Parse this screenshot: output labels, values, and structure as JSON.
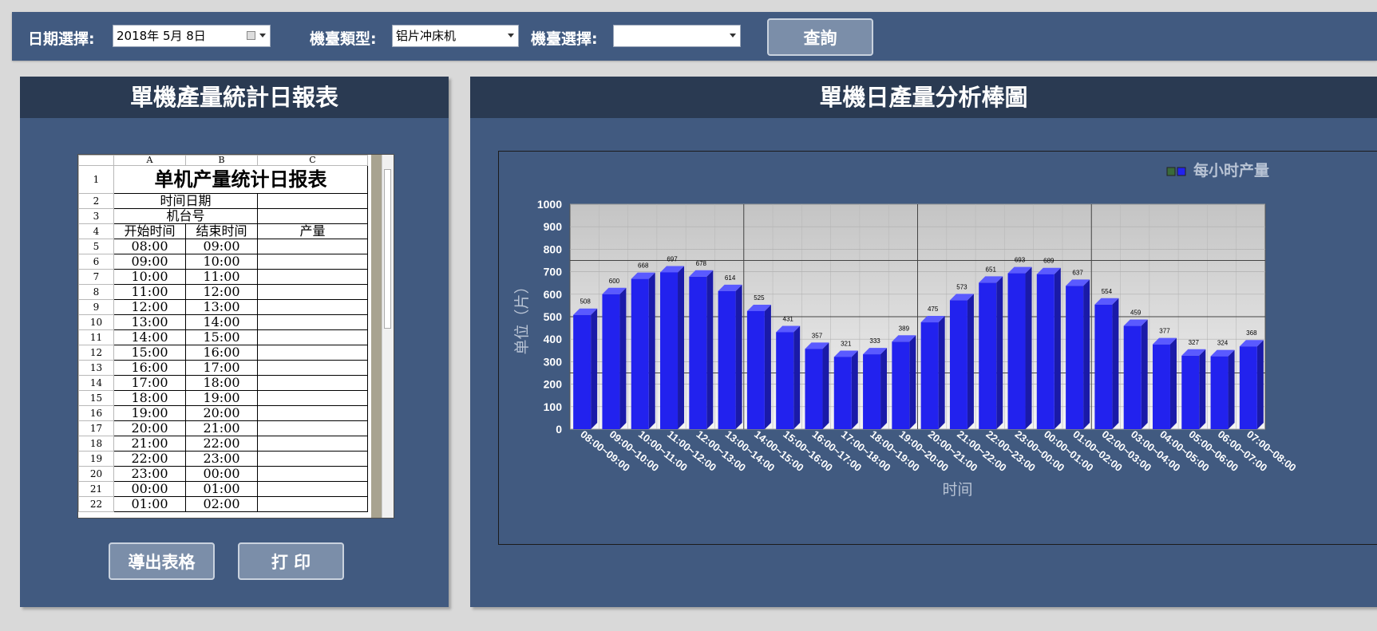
{
  "toolbar": {
    "date_label": "日期選擇:",
    "date_value": "2018年  5月  8日",
    "type_label": "機臺類型:",
    "type_value": "铝片冲床机",
    "machine_label": "機臺選擇:",
    "machine_value": "",
    "query_button": "查詢"
  },
  "left_panel": {
    "title": "單機產量統計日報表",
    "export_button": "導出表格",
    "print_button": "打 印"
  },
  "sheet": {
    "col_headers": [
      "A",
      "B",
      "C"
    ],
    "title": "单机产量统计日报表",
    "date_row_label": "时间日期",
    "machine_row_label": "机台号",
    "header_start": "开始时间",
    "header_end": "结束时间",
    "header_output": "产量",
    "rows": [
      {
        "n": "5",
        "start": "08:00",
        "end": "09:00"
      },
      {
        "n": "6",
        "start": "09:00",
        "end": "10:00"
      },
      {
        "n": "7",
        "start": "10:00",
        "end": "11:00"
      },
      {
        "n": "8",
        "start": "11:00",
        "end": "12:00"
      },
      {
        "n": "9",
        "start": "12:00",
        "end": "13:00"
      },
      {
        "n": "10",
        "start": "13:00",
        "end": "14:00"
      },
      {
        "n": "11",
        "start": "14:00",
        "end": "15:00"
      },
      {
        "n": "12",
        "start": "15:00",
        "end": "16:00"
      },
      {
        "n": "13",
        "start": "16:00",
        "end": "17:00"
      },
      {
        "n": "14",
        "start": "17:00",
        "end": "18:00"
      },
      {
        "n": "15",
        "start": "18:00",
        "end": "19:00"
      },
      {
        "n": "16",
        "start": "19:00",
        "end": "20:00"
      },
      {
        "n": "17",
        "start": "20:00",
        "end": "21:00"
      },
      {
        "n": "18",
        "start": "21:00",
        "end": "22:00"
      },
      {
        "n": "19",
        "start": "22:00",
        "end": "23:00"
      },
      {
        "n": "20",
        "start": "23:00",
        "end": "00:00"
      },
      {
        "n": "21",
        "start": "00:00",
        "end": "01:00"
      },
      {
        "n": "22",
        "start": "01:00",
        "end": "02:00"
      }
    ]
  },
  "right_panel": {
    "title": "單機日產量分析棒圖"
  },
  "chart_data": {
    "type": "bar",
    "legend": "每小时产量",
    "legend_position": "top-right",
    "ylabel": "单位（片）",
    "xlabel": "时间",
    "ylim": [
      0,
      1000
    ],
    "yticks": [
      0,
      100,
      200,
      300,
      400,
      500,
      600,
      700,
      800,
      900,
      1000
    ],
    "categories": [
      "08:00~09:00",
      "09:00~10:00",
      "10:00~11:00",
      "11:00~12:00",
      "12:00~13:00",
      "13:00~14:00",
      "14:00~15:00",
      "15:00~16:00",
      "16:00~17:00",
      "17:00~18:00",
      "18:00~19:00",
      "19:00~20:00",
      "20:00~21:00",
      "21:00~22:00",
      "22:00~23:00",
      "23:00~00:00",
      "00:00~01:00",
      "01:00~02:00",
      "02:00~03:00",
      "03:00~04:00",
      "04:00~05:00",
      "05:00~06:00",
      "06:00~07:00",
      "07:00~08:00"
    ],
    "values": [
      508,
      600,
      668,
      697,
      678,
      614,
      525,
      431,
      357,
      321,
      333,
      389,
      475,
      573,
      651,
      693,
      689,
      637,
      554,
      459,
      377,
      327,
      324,
      368
    ],
    "bar_color": "#2222ee",
    "grid": true
  }
}
